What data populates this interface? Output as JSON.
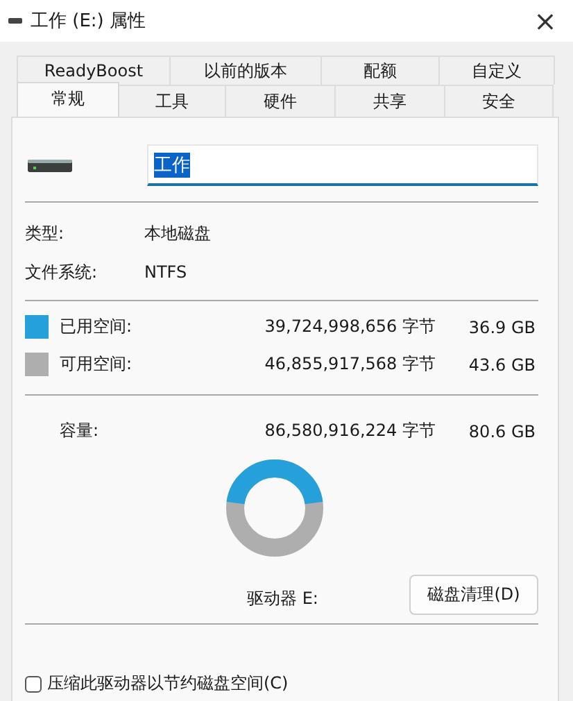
{
  "window": {
    "title": "工作 (E:) 属性",
    "close": "×"
  },
  "tab_rows": [
    [
      {
        "label": "ReadyBoost",
        "selected": false
      },
      {
        "label": "以前的版本",
        "selected": false
      },
      {
        "label": "配额",
        "selected": false
      },
      {
        "label": "自定义",
        "selected": false
      }
    ],
    [
      {
        "label": "常规",
        "selected": true
      },
      {
        "label": "工具",
        "selected": false
      },
      {
        "label": "硬件",
        "selected": false
      },
      {
        "label": "共享",
        "selected": false
      },
      {
        "label": "安全",
        "selected": false
      }
    ]
  ],
  "name_field": {
    "value": "工作"
  },
  "info": [
    {
      "label": "类型:",
      "value": "本地磁盘"
    },
    {
      "label": "文件系统:",
      "value": "NTFS"
    }
  ],
  "space": [
    {
      "color": "#26a0da",
      "label": "已用空间:",
      "bytes": "39,724,998,656 字节",
      "size": "36.9 GB"
    },
    {
      "color": "#aeaeae",
      "label": "可用空间:",
      "bytes": "46,855,917,568 字节",
      "size": "43.6 GB"
    }
  ],
  "capacity": {
    "label": "容量:",
    "bytes": "86,580,916,224 字节",
    "size": "80.6 GB"
  },
  "drive_label": "驱动器 E:",
  "cleanup_button": "磁盘清理(D)",
  "compress": {
    "label": "压缩此驱动器以节约磁盘空间(C)",
    "checked": false
  }
}
